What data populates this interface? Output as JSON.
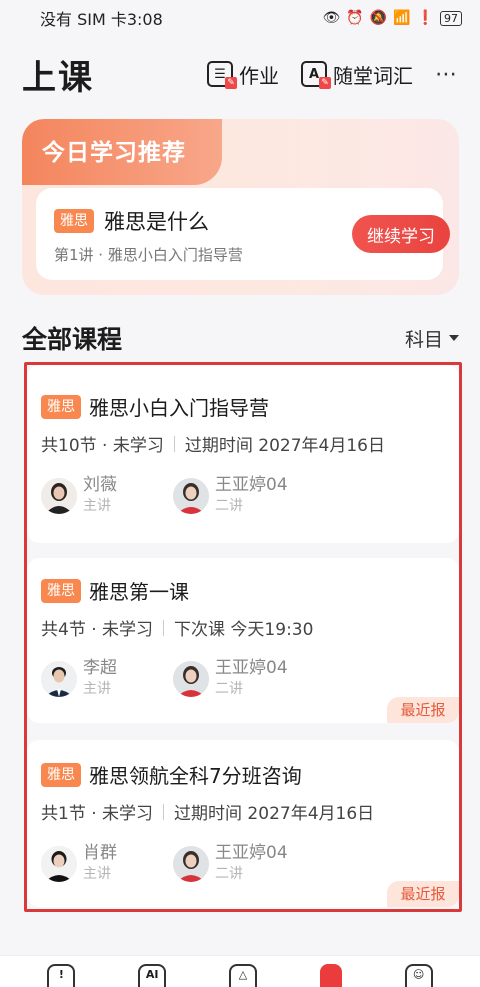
{
  "status": {
    "carrier_time": "没有 SIM 卡3:08",
    "battery": "97"
  },
  "header": {
    "title": "上课",
    "homework_label": "作业",
    "vocab_label": "随堂词汇"
  },
  "recommend": {
    "title": "今日学习推荐",
    "tag": "雅思",
    "course_name": "雅思是什么",
    "subtitle": "第1讲 · 雅思小白入门指导营",
    "button": "继续学习"
  },
  "section": {
    "title": "全部课程",
    "filter_label": "科目"
  },
  "courses": [
    {
      "tag": "雅思",
      "name": "雅思小白入门指导营",
      "meta_left": "共10节 · 未学习",
      "meta_right": "过期时间 2027年4月16日",
      "teachers": [
        {
          "name": "刘薇",
          "role": "主讲"
        },
        {
          "name": "王亚婷04",
          "role": "二讲"
        }
      ]
    },
    {
      "tag": "雅思",
      "name": "雅思第一课",
      "meta_left": "共4节 · 未学习",
      "meta_right": "下次课 今天19:30",
      "teachers": [
        {
          "name": "李超",
          "role": "主讲"
        },
        {
          "name": "王亚婷04",
          "role": "二讲"
        }
      ],
      "badge": "最近报"
    },
    {
      "tag": "雅思",
      "name": "雅思领航全科7分班咨询",
      "meta_left": "共1节 · 未学习",
      "meta_right": "过期时间 2027年4月16日",
      "teachers": [
        {
          "name": "肖群",
          "role": "主讲"
        },
        {
          "name": "王亚婷04",
          "role": "二讲"
        }
      ],
      "badge": "最近报"
    }
  ],
  "nav": {
    "ai_label": "AI"
  },
  "colors": {
    "accent": "#ea3c3c",
    "tag": "#f8884f",
    "rec_bg": "#fde6de"
  }
}
